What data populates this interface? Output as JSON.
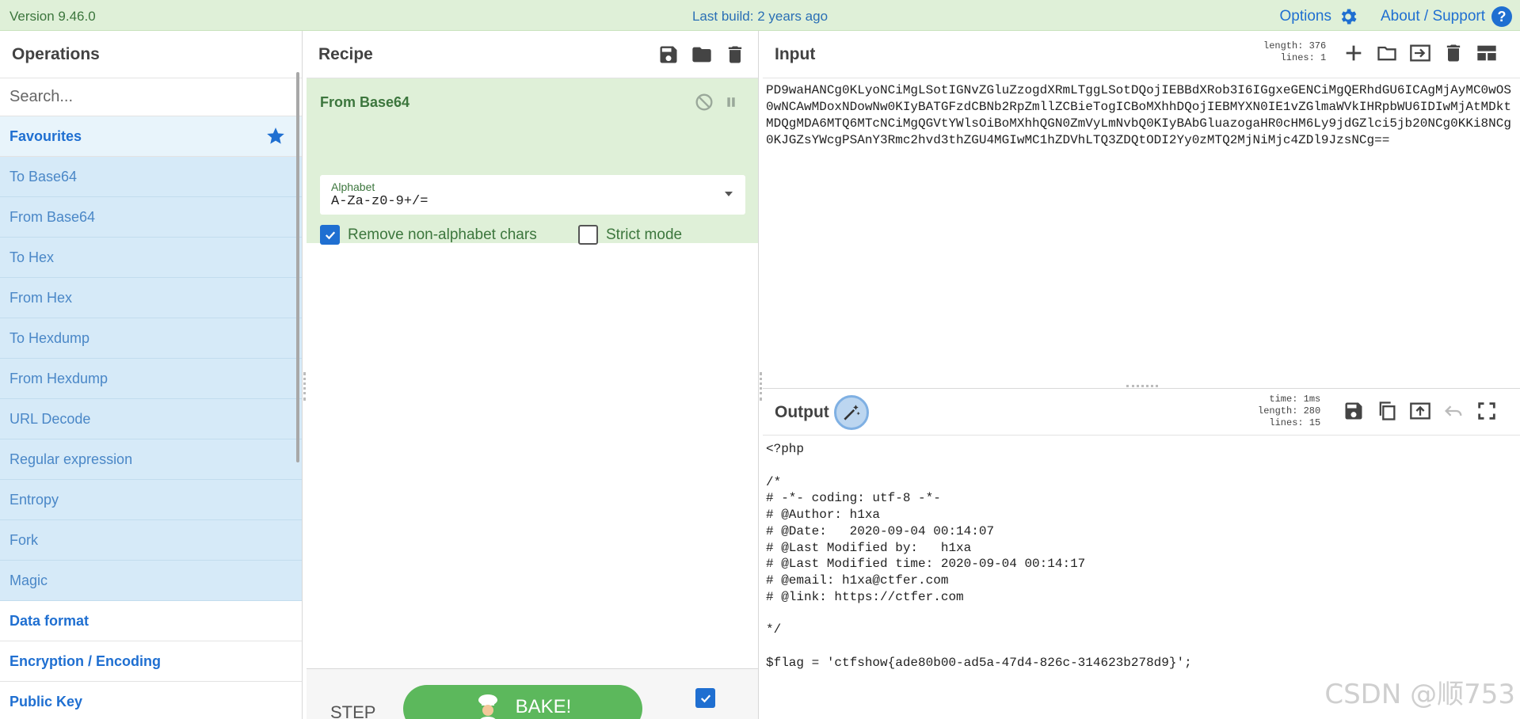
{
  "banner": {
    "version": "Version 9.46.0",
    "last_build": "Last build: 2 years ago",
    "options_label": "Options",
    "about_label": "About / Support",
    "help_glyph": "?"
  },
  "operations": {
    "title": "Operations",
    "search_placeholder": "Search...",
    "favourites_label": "Favourites",
    "items": [
      "To Base64",
      "From Base64",
      "To Hex",
      "From Hex",
      "To Hexdump",
      "From Hexdump",
      "URL Decode",
      "Regular expression",
      "Entropy",
      "Fork",
      "Magic"
    ],
    "categories": [
      "Data format",
      "Encryption / Encoding",
      "Public Key"
    ]
  },
  "recipe": {
    "title": "Recipe",
    "operation": {
      "name": "From Base64",
      "alphabet_label": "Alphabet",
      "alphabet_value": "A-Za-z0-9+/=",
      "remove_nonalpha_label": "Remove non-alphabet chars",
      "remove_nonalpha_checked": true,
      "strict_mode_label": "Strict mode",
      "strict_mode_checked": false
    },
    "step_label": "STEP",
    "bake_label": "BAKE!",
    "auto_bake_checked": true
  },
  "input": {
    "title": "Input",
    "length_label": "length: 376",
    "lines_label": "lines:   1",
    "text": "PD9waHANCg0KLyoNCiMgLSotIGNvZGluZzogdXRmLTggLSotDQojIEBBdXRob3I6IGgxeGENCiMgQERhdGU6ICAgMjAyMC0wOS0wNCAwMDoxNDowNw0KIyBATGFzdCBNb2RpZmllZCBieTogICBoMXhhDQojIEBMYXN0IE1vZGlmaWVkIHRpbWU6IDIwMjAtMDktMDQgMDA6MTQ6MTcNCiMgQGVtYWlsOiBoMXhhQGN0ZmVyLmNvbQ0KIyBAbGluazogaHR0cHM6Ly9jdGZlci5jb20NCg0KKi8NCg0KJGZsYWcgPSAnY3Rmc2hvd3thZGU4MGIwMC1hZDVhLTQ3ZDQtODI2Yy0zMTQ2MjNiMjc4ZDl9JzsNCg=="
  },
  "output": {
    "title": "Output",
    "time_label": "time:  1ms",
    "length_label": "length: 280",
    "lines_label": "lines:  15",
    "text": "<?php\n\n/*\n# -*- coding: utf-8 -*-\n# @Author: h1xa\n# @Date:   2020-09-04 00:14:07\n# @Last Modified by:   h1xa\n# @Last Modified time: 2020-09-04 00:14:17\n# @email: h1xa@ctfer.com\n# @link: https://ctfer.com\n\n*/\n\n$flag = 'ctfshow{ade80b00-ad5a-47d4-826c-314623b278d9}';"
  },
  "watermark": "CSDN @顺753",
  "colors": {
    "accent": "#1f6fd1",
    "banner_bg": "#dff0d8",
    "favourites_bg": "#d6eaf8",
    "recipe_op_bg": "#dff0d8",
    "bake": "#5cb85c"
  }
}
